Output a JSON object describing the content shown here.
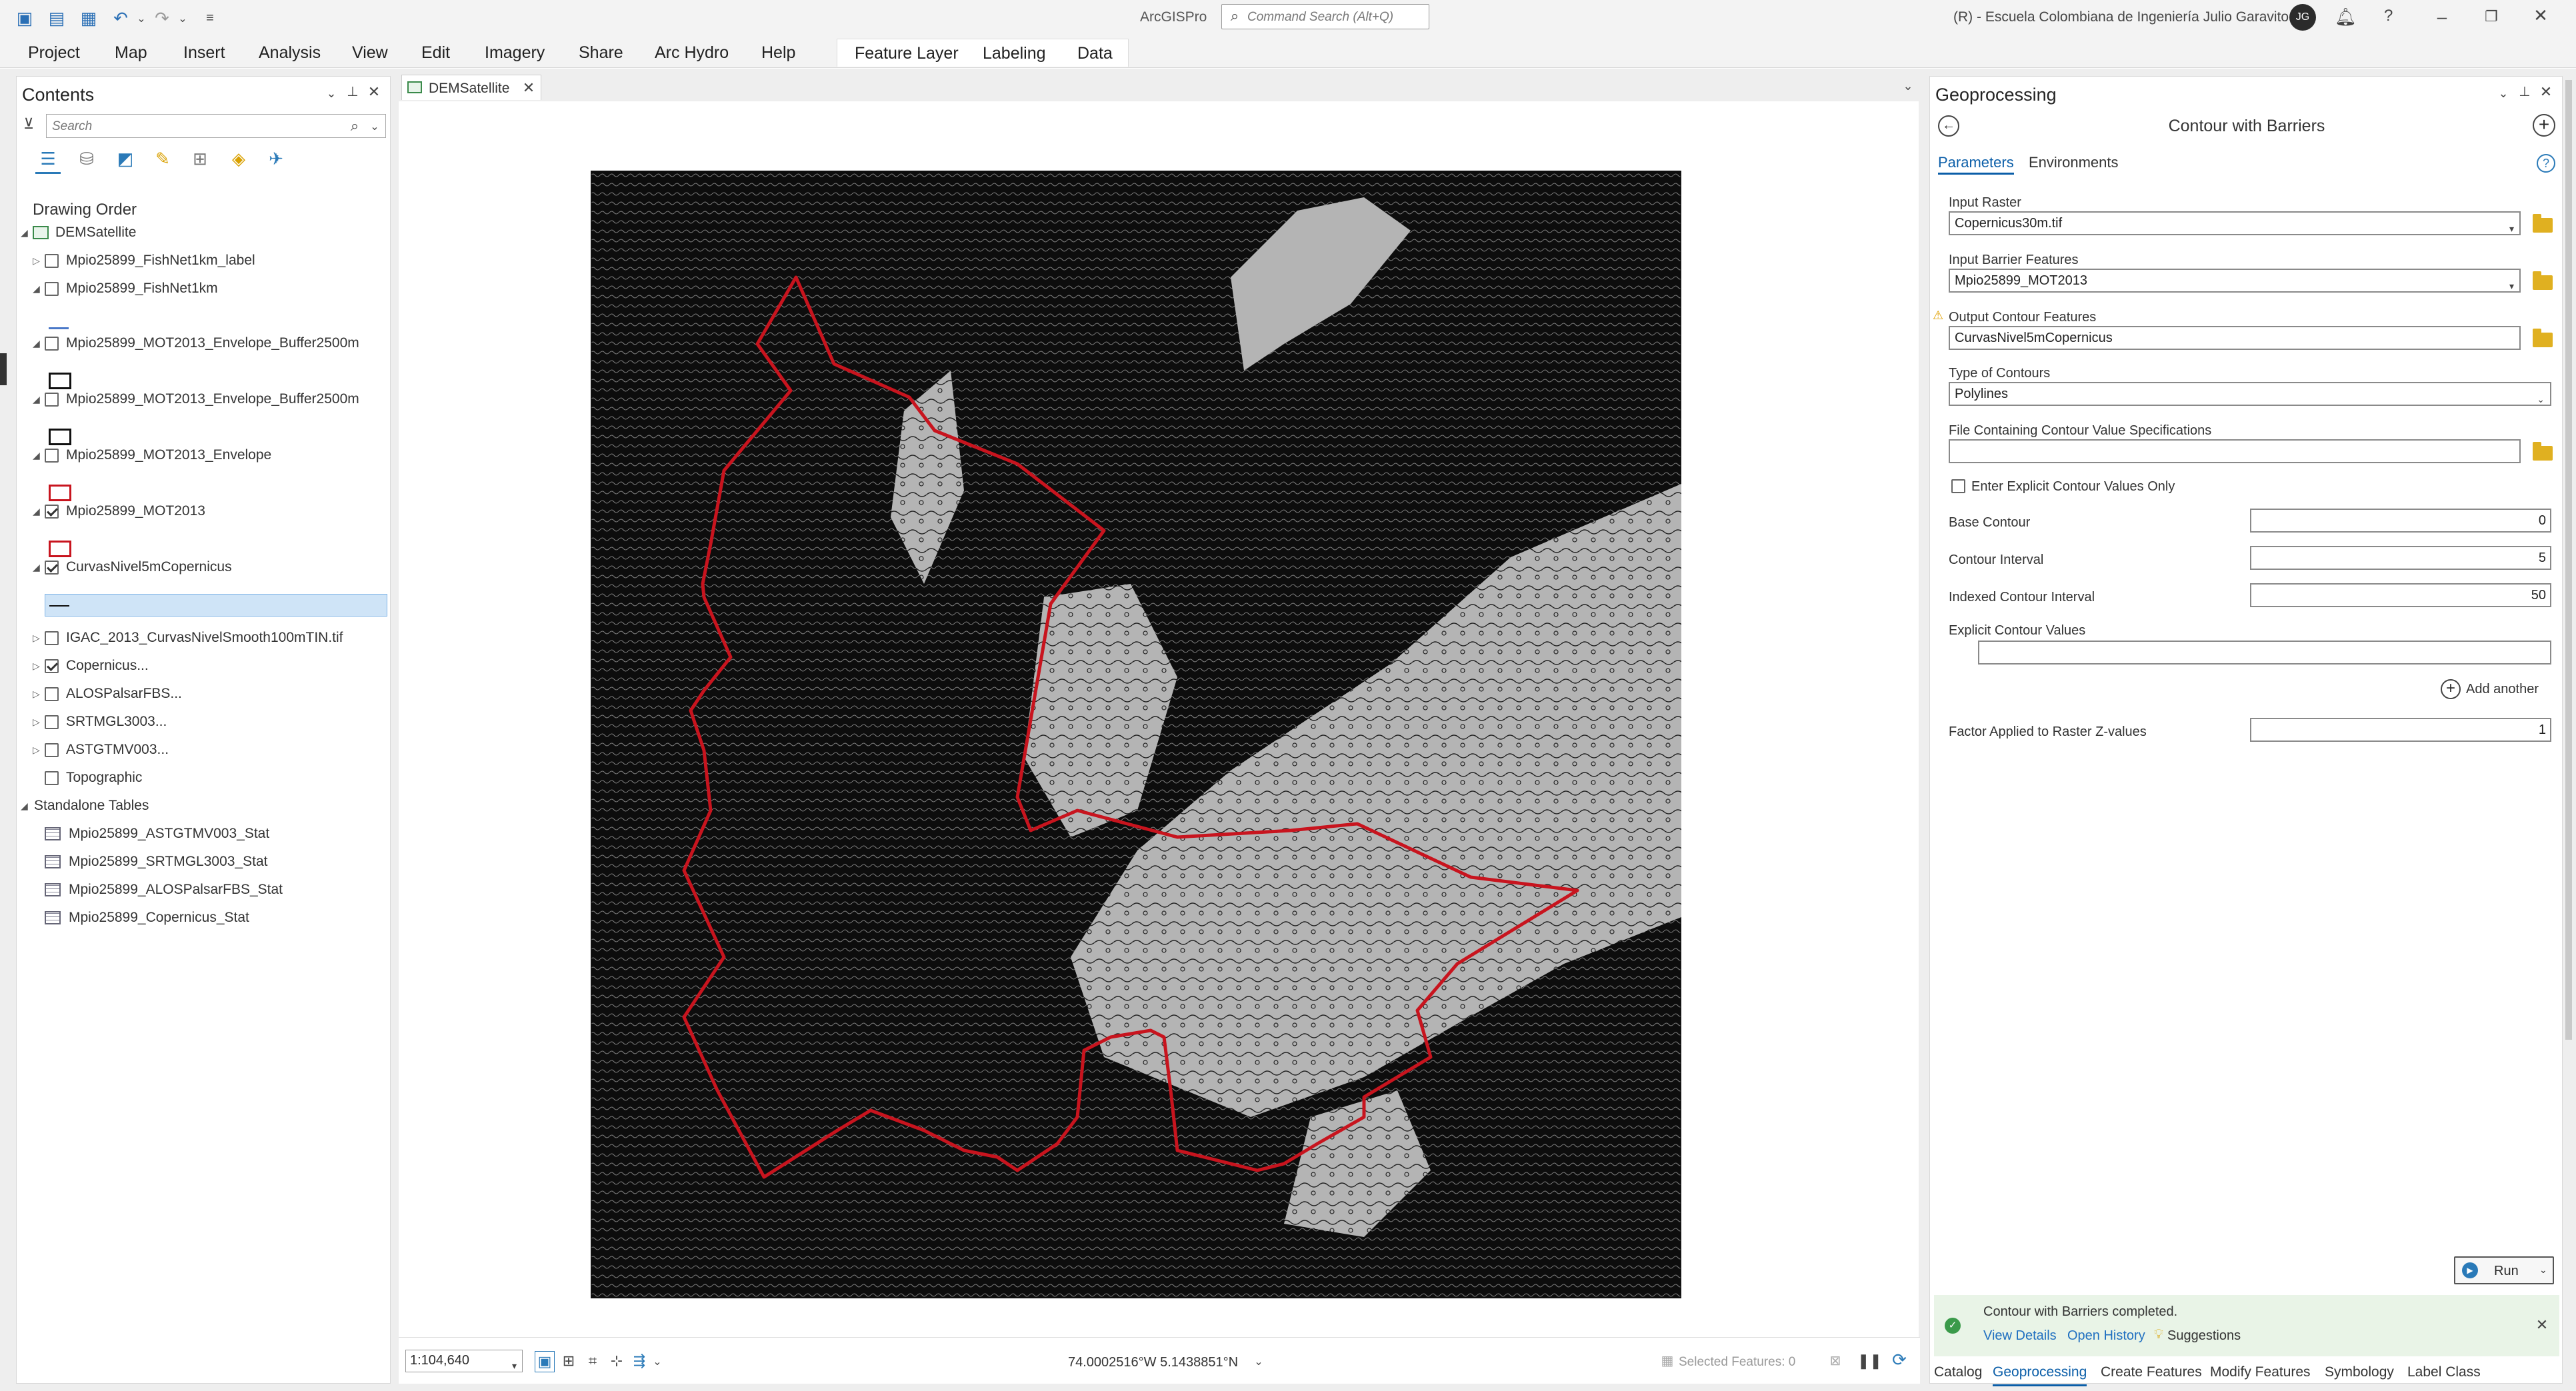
{
  "titlebar": {
    "app_name": "ArcGISPro",
    "search_placeholder": "Command Search (Alt+Q)",
    "user_org": "(R) - Escuela Colombiana de Ingeniería Julio Garavito",
    "avatar_initials": "JG",
    "help": "?"
  },
  "ribbon": {
    "tabs": [
      "Project",
      "Map",
      "Insert",
      "Analysis",
      "View",
      "Edit",
      "Imagery",
      "Share",
      "Arc Hydro",
      "Help"
    ],
    "contextual_tabs": [
      "Feature Layer",
      "Labeling",
      "Data"
    ]
  },
  "contents": {
    "title": "Contents",
    "search_placeholder": "Search",
    "drawing_order": "Drawing Order",
    "map_name": "DEMSatellite",
    "layers": [
      {
        "name": "Mpio25899_FishNet1km_label",
        "checked": false
      },
      {
        "name": "Mpio25899_FishNet1km",
        "checked": false
      },
      {
        "name": "Mpio25899_MOT2013_Envelope_Buffer2500m",
        "checked": false
      },
      {
        "name": "Mpio25899_MOT2013_Envelope_Buffer2500m",
        "checked": false
      },
      {
        "name": "Mpio25899_MOT2013_Envelope",
        "checked": false
      },
      {
        "name": "Mpio25899_MOT2013",
        "checked": true
      },
      {
        "name": "CurvasNivel5mCopernicus",
        "checked": true
      },
      {
        "name": "IGAC_2013_CurvasNivelSmooth100mTIN.tif",
        "checked": false
      },
      {
        "name": "Copernicus...",
        "checked": true
      },
      {
        "name": "ALOSPalsarFBS...",
        "checked": false
      },
      {
        "name": "SRTMGL3003...",
        "checked": false
      },
      {
        "name": "ASTGTMV003...",
        "checked": false
      },
      {
        "name": "Topographic",
        "checked": false
      }
    ],
    "standalone_title": "Standalone Tables",
    "tables": [
      "Mpio25899_ASTGTMV003_Stat",
      "Mpio25899_SRTMGL3003_Stat",
      "Mpio25899_ALOSPalsarFBS_Stat",
      "Mpio25899_Copernicus_Stat"
    ]
  },
  "map_view": {
    "tab_title": "DEMSatellite",
    "scale": "1:104,640",
    "coordinates": "74.0002516°W 5.1438851°N",
    "selected_features": "Selected Features: 0",
    "colors": {
      "terrain_dark": "#0a0a0a",
      "terrain_light": "#b4b4b4",
      "boundary": "#c8141e"
    }
  },
  "geoprocessing": {
    "pane_title": "Geoprocessing",
    "tool_title": "Contour with Barriers",
    "tabs": {
      "parameters": "Parameters",
      "environments": "Environments"
    },
    "input_raster_label": "Input Raster",
    "input_raster_value": "Copernicus30m.tif",
    "barrier_label": "Input Barrier Features",
    "barrier_value": "Mpio25899_MOT2013",
    "output_label": "Output Contour Features",
    "output_value": "CurvasNivel5mCopernicus",
    "type_label": "Type of Contours",
    "type_value": "Polylines",
    "file_label": "File Containing Contour Value Specifications",
    "explicit_only_label": "Enter Explicit Contour Values Only",
    "base_label": "Base Contour",
    "base_value": "0",
    "interval_label": "Contour Interval",
    "interval_value": "5",
    "indexed_label": "Indexed Contour Interval",
    "indexed_value": "50",
    "explicit_values_label": "Explicit Contour Values",
    "add_another": "Add another",
    "factor_label": "Factor Applied to Raster Z-values",
    "factor_value": "1",
    "run_label": "Run",
    "status_text": "Contour with Barriers completed.",
    "view_details": "View Details",
    "open_history": "Open History",
    "suggestions": "Suggestions"
  },
  "bottom_tabs": [
    "Catalog",
    "Geoprocessing",
    "Create Features",
    "Modify Features",
    "Symbology",
    "Label Class"
  ]
}
